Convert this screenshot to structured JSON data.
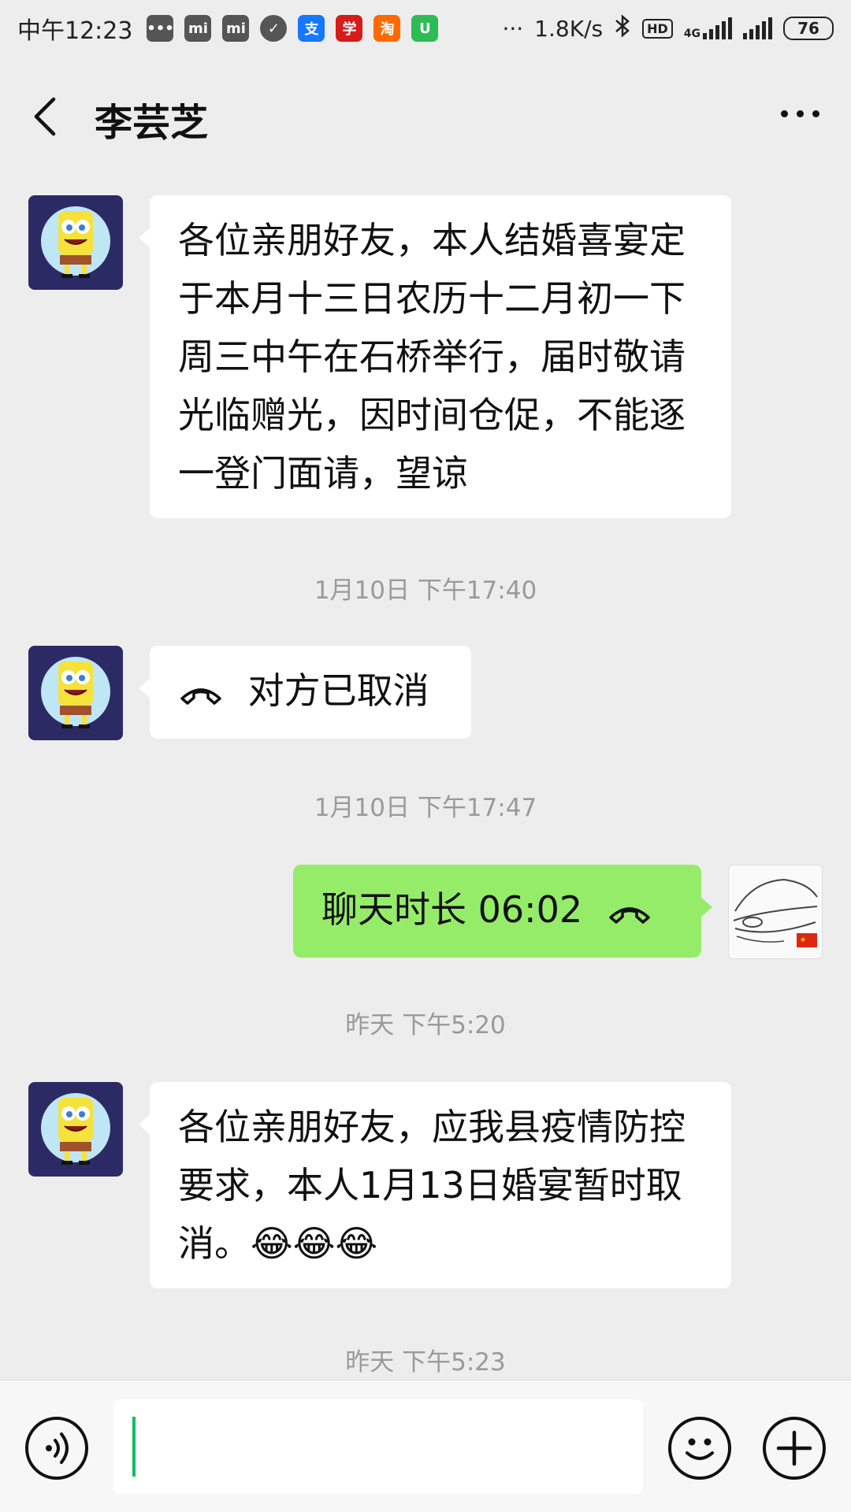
{
  "status_bar": {
    "time": "中午12:23",
    "net_speed": "1.8K/s",
    "network": "4G",
    "hd": "HD",
    "battery": "76",
    "more": "···"
  },
  "header": {
    "title": "李芸芝"
  },
  "messages": [
    {
      "side": "left",
      "text": "各位亲朋好友，本人结婚喜宴定于本月十三日农历十二月初一下周三中午在石桥举行，届时敬请光临赠光，因时间仓促，不能逐一登门面请，望谅"
    },
    {
      "timestamp": "1月10日 下午17:40"
    },
    {
      "side": "left",
      "text": "对方已取消"
    },
    {
      "timestamp": "1月10日 下午17:47"
    },
    {
      "side": "right",
      "text": "聊天时长 06:02"
    },
    {
      "timestamp": "昨天 下午5:20"
    },
    {
      "side": "left",
      "text": "各位亲朋好友，应我县疫情防控要求，本人1月13日婚宴暂时取消。",
      "emoji": "😂😂😂"
    },
    {
      "timestamp": "昨天 下午5:23"
    }
  ],
  "colors": {
    "bubble_sent": "#95ec69",
    "bubble_received": "#ffffff",
    "background": "#ededed",
    "caret": "#07c160"
  },
  "icons": [
    "back-icon",
    "more-icon",
    "voice-icon",
    "emoji-icon",
    "plus-icon",
    "phone-hangup-icon"
  ]
}
